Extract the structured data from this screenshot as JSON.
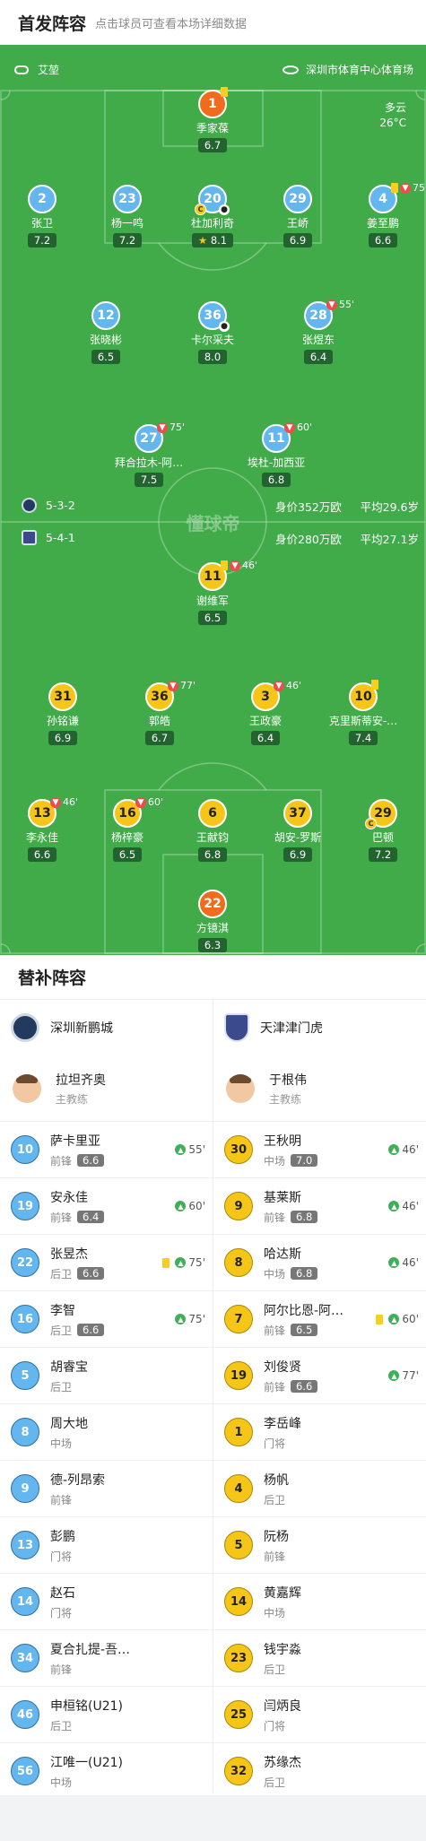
{
  "header": {
    "title": "首发阵容",
    "subtitle": "点击球员可查看本场详细数据"
  },
  "pitch": {
    "referee": "艾堃",
    "venue": "深圳市体育中心体育场",
    "weather": "多云",
    "temperature": "26°C",
    "watermark": "懂球帝",
    "home_formation": {
      "formation": "5-3-2",
      "value": "身价352万欧",
      "age": "平均29.6岁"
    },
    "away_formation": {
      "formation": "5-4-1",
      "value": "身价280万欧",
      "age": "平均27.1岁"
    }
  },
  "home_players": [
    {
      "num": "1",
      "name": "季家葆",
      "rating": "6.7",
      "style": "gk",
      "marks": "",
      "yellow": true,
      "subbed": false,
      "captain": false,
      "goal": false,
      "top": false
    },
    {
      "num": "2",
      "name": "张卫",
      "rating": "7.2",
      "style": "blue",
      "marks": "",
      "yellow": false,
      "subbed": false,
      "captain": false,
      "goal": false,
      "top": false
    },
    {
      "num": "23",
      "name": "杨一鸣",
      "rating": "7.2",
      "style": "blue",
      "marks": "",
      "yellow": false,
      "subbed": false,
      "captain": false,
      "goal": false,
      "top": false
    },
    {
      "num": "20",
      "name": "杜加利奇",
      "rating": "8.1",
      "style": "blue",
      "marks": "",
      "yellow": false,
      "subbed": false,
      "captain": true,
      "goal": true,
      "top": true
    },
    {
      "num": "29",
      "name": "王峤",
      "rating": "6.9",
      "style": "blue",
      "marks": "",
      "yellow": false,
      "subbed": false,
      "captain": false,
      "goal": false,
      "top": false
    },
    {
      "num": "4",
      "name": "姜至鹏",
      "rating": "6.6",
      "style": "blue",
      "marks": "75'",
      "yellow": true,
      "subbed": true,
      "captain": false,
      "goal": false,
      "top": false
    },
    {
      "num": "12",
      "name": "张晓彬",
      "rating": "6.5",
      "style": "blue",
      "marks": "",
      "yellow": false,
      "subbed": false,
      "captain": false,
      "goal": false,
      "top": false
    },
    {
      "num": "36",
      "name": "卡尔采夫",
      "rating": "8.0",
      "style": "blue",
      "marks": "",
      "yellow": false,
      "subbed": false,
      "captain": false,
      "goal": true,
      "top": false
    },
    {
      "num": "28",
      "name": "张煜东",
      "rating": "6.4",
      "style": "blue",
      "marks": "55'",
      "yellow": false,
      "subbed": true,
      "captain": false,
      "goal": false,
      "top": false
    },
    {
      "num": "27",
      "name": "拜合拉木-阿…",
      "rating": "7.5",
      "style": "blue",
      "marks": "75'",
      "yellow": false,
      "subbed": true,
      "captain": false,
      "goal": false,
      "top": false
    },
    {
      "num": "11",
      "name": "埃杜-加西亚",
      "rating": "6.8",
      "style": "blue",
      "marks": "60'",
      "yellow": false,
      "subbed": true,
      "captain": false,
      "goal": false,
      "top": false
    }
  ],
  "away_players": [
    {
      "num": "11",
      "name": "谢维军",
      "rating": "6.5",
      "style": "yellow",
      "marks": "46'",
      "yellow": true,
      "subbed": true,
      "captain": false
    },
    {
      "num": "31",
      "name": "孙铭谦",
      "rating": "6.9",
      "style": "yellow",
      "marks": "",
      "yellow": false,
      "subbed": false,
      "captain": false
    },
    {
      "num": "36",
      "name": "郭皓",
      "rating": "6.7",
      "style": "yellow",
      "marks": "77'",
      "yellow": false,
      "subbed": true,
      "captain": false
    },
    {
      "num": "3",
      "name": "王政豪",
      "rating": "6.4",
      "style": "yellow",
      "marks": "46'",
      "yellow": false,
      "subbed": true,
      "captain": false
    },
    {
      "num": "10",
      "name": "克里斯蒂安-…",
      "rating": "7.4",
      "style": "yellow",
      "marks": "",
      "yellow": true,
      "subbed": false,
      "captain": false
    },
    {
      "num": "13",
      "name": "李永佳",
      "rating": "6.6",
      "style": "yellow",
      "marks": "46'",
      "yellow": false,
      "subbed": true,
      "captain": false
    },
    {
      "num": "16",
      "name": "杨梓豪",
      "rating": "6.5",
      "style": "yellow",
      "marks": "60'",
      "yellow": false,
      "subbed": true,
      "captain": false
    },
    {
      "num": "6",
      "name": "王献钧",
      "rating": "6.8",
      "style": "yellow",
      "marks": "",
      "yellow": false,
      "subbed": false,
      "captain": false
    },
    {
      "num": "37",
      "name": "胡安-罗斯",
      "rating": "6.9",
      "style": "yellow",
      "marks": "",
      "yellow": false,
      "subbed": false,
      "captain": false
    },
    {
      "num": "29",
      "name": "巴顿",
      "rating": "7.2",
      "style": "yellow",
      "marks": "",
      "yellow": false,
      "subbed": false,
      "captain": true
    },
    {
      "num": "22",
      "name": "方镜淇",
      "rating": "6.3",
      "style": "gk",
      "marks": "",
      "yellow": false,
      "subbed": false,
      "captain": false
    }
  ],
  "subs": {
    "title": "替补阵容",
    "home": {
      "team": "深圳新鹏城",
      "coach": "拉坦齐奥",
      "coach_role": "主教练",
      "players": [
        {
          "num": "10",
          "name": "萨卡里亚",
          "role": "前锋",
          "rating": "6.6",
          "in": "55'",
          "yellow": false
        },
        {
          "num": "19",
          "name": "安永佳",
          "role": "前锋",
          "rating": "6.4",
          "in": "60'",
          "yellow": false
        },
        {
          "num": "22",
          "name": "张昱杰",
          "role": "后卫",
          "rating": "6.6",
          "in": "75'",
          "yellow": true
        },
        {
          "num": "16",
          "name": "李智",
          "role": "后卫",
          "rating": "6.6",
          "in": "75'",
          "yellow": false
        },
        {
          "num": "5",
          "name": "胡睿宝",
          "role": "后卫",
          "rating": "",
          "in": "",
          "yellow": false
        },
        {
          "num": "8",
          "name": "周大地",
          "role": "中场",
          "rating": "",
          "in": "",
          "yellow": false
        },
        {
          "num": "9",
          "name": "德-列昂索",
          "role": "前锋",
          "rating": "",
          "in": "",
          "yellow": false
        },
        {
          "num": "13",
          "name": "彭鹏",
          "role": "门将",
          "rating": "",
          "in": "",
          "yellow": false
        },
        {
          "num": "14",
          "name": "赵石",
          "role": "门将",
          "rating": "",
          "in": "",
          "yellow": false
        },
        {
          "num": "34",
          "name": "夏合扎提-吾…",
          "role": "前锋",
          "rating": "",
          "in": "",
          "yellow": false
        },
        {
          "num": "46",
          "name": "申桓铭(U21)",
          "role": "后卫",
          "rating": "",
          "in": "",
          "yellow": false
        },
        {
          "num": "56",
          "name": "江唯一(U21)",
          "role": "中场",
          "rating": "",
          "in": "",
          "yellow": false
        }
      ]
    },
    "away": {
      "team": "天津津门虎",
      "coach": "于根伟",
      "coach_role": "主教练",
      "players": [
        {
          "num": "30",
          "name": "王秋明",
          "role": "中场",
          "rating": "7.0",
          "in": "46'",
          "yellow": false
        },
        {
          "num": "9",
          "name": "基莱斯",
          "role": "前锋",
          "rating": "6.8",
          "in": "46'",
          "yellow": false
        },
        {
          "num": "8",
          "name": "哈达斯",
          "role": "中场",
          "rating": "6.8",
          "in": "46'",
          "yellow": false
        },
        {
          "num": "7",
          "name": "阿尔比恩-阿…",
          "role": "前锋",
          "rating": "6.5",
          "in": "60'",
          "yellow": true
        },
        {
          "num": "19",
          "name": "刘俊贤",
          "role": "前锋",
          "rating": "6.6",
          "in": "77'",
          "yellow": false
        },
        {
          "num": "1",
          "name": "李岳峰",
          "role": "门将",
          "rating": "",
          "in": "",
          "yellow": false
        },
        {
          "num": "4",
          "name": "杨帆",
          "role": "后卫",
          "rating": "",
          "in": "",
          "yellow": false
        },
        {
          "num": "5",
          "name": "阮杨",
          "role": "前锋",
          "rating": "",
          "in": "",
          "yellow": false
        },
        {
          "num": "14",
          "name": "黄嘉辉",
          "role": "中场",
          "rating": "",
          "in": "",
          "yellow": false
        },
        {
          "num": "23",
          "name": "钱宇淼",
          "role": "后卫",
          "rating": "",
          "in": "",
          "yellow": false
        },
        {
          "num": "25",
          "name": "闫炳良",
          "role": "门将",
          "rating": "",
          "in": "",
          "yellow": false
        },
        {
          "num": "32",
          "name": "苏缘杰",
          "role": "后卫",
          "rating": "",
          "in": "",
          "yellow": false
        }
      ]
    }
  },
  "colors": {
    "pitch": "#41ab4a",
    "home": "#64b7ee",
    "away": "#f5c518",
    "gk_home": "#f26b1d",
    "rating_bg": "#22632f"
  }
}
